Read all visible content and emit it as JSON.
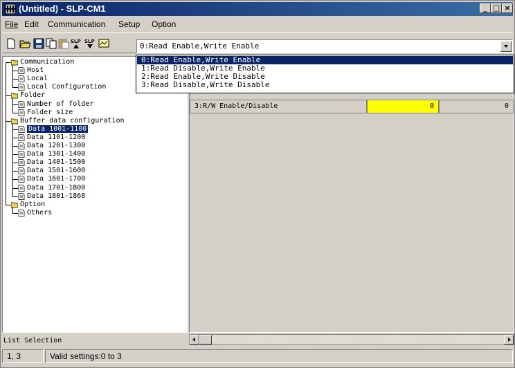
{
  "window": {
    "title": "(Untitled) - SLP-CM1"
  },
  "menu": [
    {
      "label": "File"
    },
    {
      "label": "Edit"
    },
    {
      "label": "Communication"
    },
    {
      "label": "Setup"
    },
    {
      "label": "Option"
    }
  ],
  "toolbar": {
    "buttons": [
      "new-icon",
      "open-icon",
      "save-icon",
      "copy-icon",
      "paste-icon",
      "slp-upload-icon",
      "slp-download-icon",
      "monitor-icon"
    ],
    "combo_value": "0:Read Enable,Write Enable"
  },
  "dropdown": {
    "options": [
      "0:Read Enable,Write Enable",
      "1:Read Disable,Write Enable",
      "2:Read Enable,Write Disable",
      "3:Read Disable,Write Disable"
    ],
    "selected_index": 0
  },
  "tree": [
    {
      "label": "Communication",
      "type": "folder"
    },
    {
      "label": "Host",
      "type": "doc"
    },
    {
      "label": "Local",
      "type": "doc"
    },
    {
      "label": "Local Configuration",
      "type": "doc"
    },
    {
      "label": "Folder",
      "type": "folder"
    },
    {
      "label": "Number of folder",
      "type": "doc"
    },
    {
      "label": "Folder size",
      "type": "doc"
    },
    {
      "label": "Buffer data configuration",
      "type": "folder"
    },
    {
      "label": "Data 1001-1100",
      "type": "doc",
      "selected": true
    },
    {
      "label": "Data 1101-1200",
      "type": "doc"
    },
    {
      "label": "Data 1201-1300",
      "type": "doc"
    },
    {
      "label": "Data 1301-1400",
      "type": "doc"
    },
    {
      "label": "Data 1401-1500",
      "type": "doc"
    },
    {
      "label": "Data 1501-1600",
      "type": "doc"
    },
    {
      "label": "Data 1601-1700",
      "type": "doc"
    },
    {
      "label": "Data 1701-1800",
      "type": "doc"
    },
    {
      "label": "Data 1801-1868",
      "type": "doc"
    },
    {
      "label": "Option",
      "type": "folder"
    },
    {
      "label": "Others",
      "type": "doc"
    }
  ],
  "list_selection_label": "List Selection",
  "grid": {
    "row_label": "3:R/W Enable/Disable",
    "value_active": "0",
    "value_other": "0"
  },
  "status": {
    "position": "1, 3",
    "message": "Valid settings:0 to 3"
  },
  "colors": {
    "titlebar": "#0a246a",
    "highlight": "#0a246a",
    "active_cell": "#ffff00",
    "face": "#d4d0c8"
  }
}
